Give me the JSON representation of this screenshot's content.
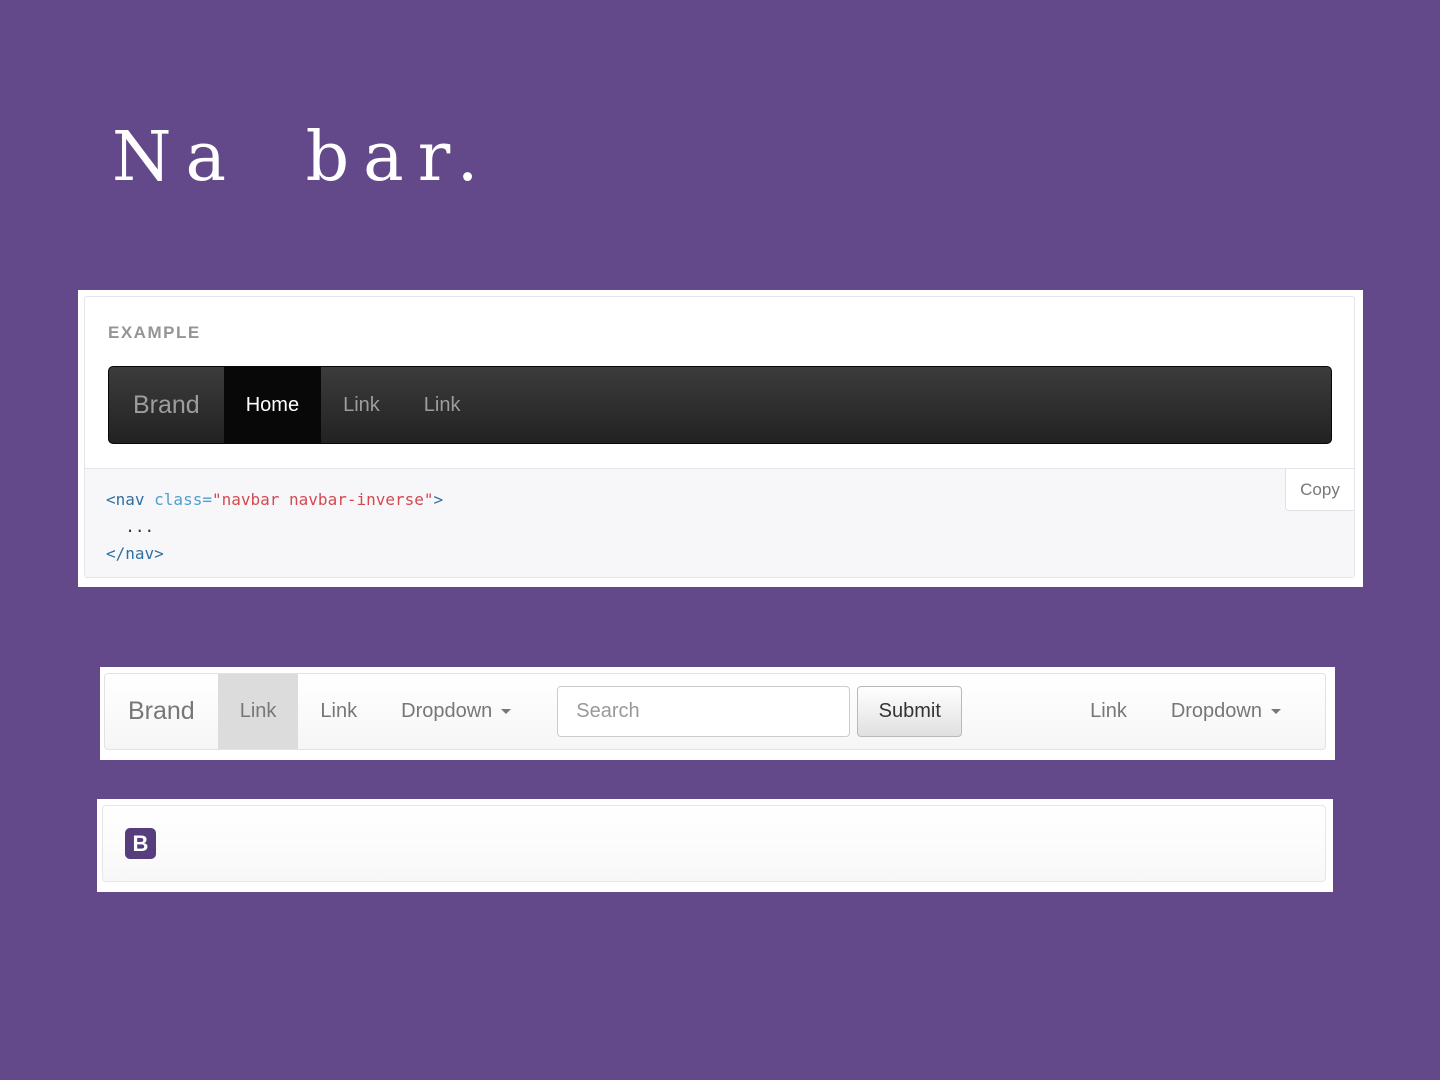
{
  "slide_title": "Na bar.",
  "example": {
    "label": "EXAMPLE",
    "navbar": {
      "brand": "Brand",
      "items": [
        "Home",
        "Link",
        "Link"
      ]
    },
    "code": {
      "open_tag": "<nav",
      "attr": " class=",
      "value": "\"navbar navbar-inverse\"",
      "close_bracket": ">",
      "dots": "  ...",
      "end_tag": "</nav>"
    },
    "copy_label": "Copy"
  },
  "default_navbar": {
    "brand": "Brand",
    "left_items": [
      "Link",
      "Link",
      "Dropdown"
    ],
    "search_placeholder": "Search",
    "submit_label": "Submit",
    "right_items": [
      "Link",
      "Dropdown"
    ]
  },
  "logo_navbar": {
    "logo_letter": "B",
    "logo_color": "#563d7c"
  }
}
